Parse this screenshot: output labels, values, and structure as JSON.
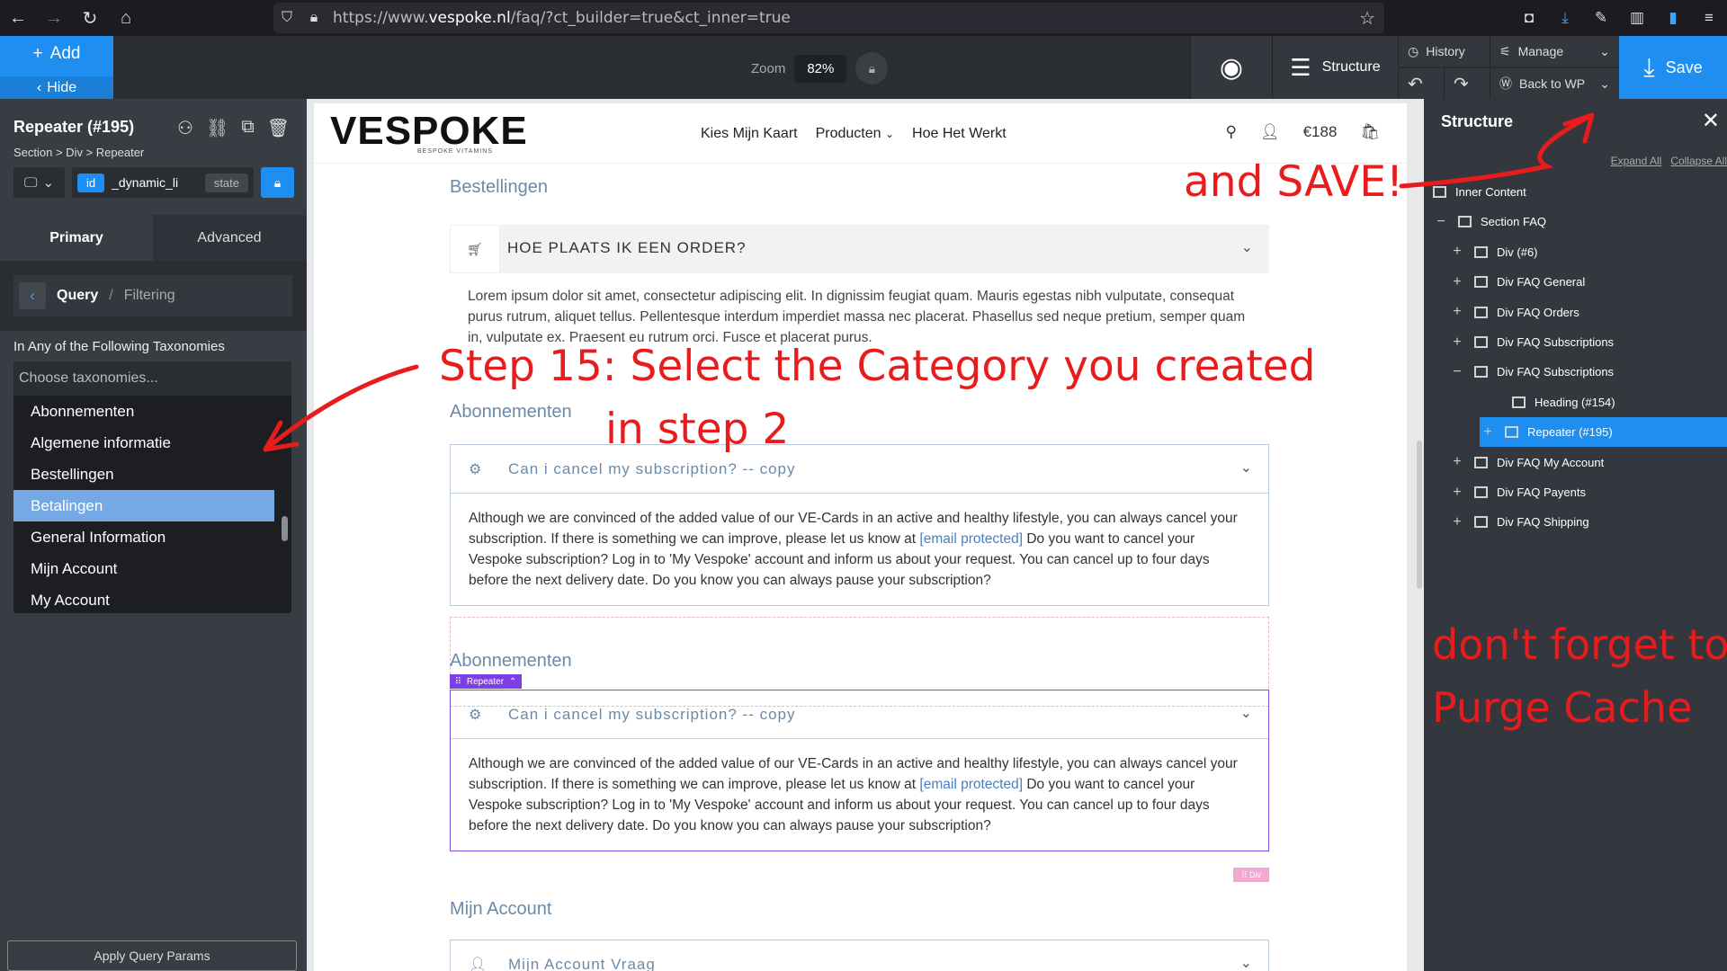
{
  "browser": {
    "url_prefix": "https://www.",
    "url_domain": "vespoke.nl",
    "url_rest": "/faq/?ct_builder=true&ct_inner=true"
  },
  "toolbar": {
    "add_label": "Add",
    "hide_label": "Hide",
    "zoom_label": "Zoom",
    "zoom_value": "82%",
    "structure_label": "Structure",
    "history_label": "History",
    "manage_label": "Manage",
    "back_label": "Back to WP",
    "save_label": "Save"
  },
  "left_panel": {
    "title": "Repeater (#195)",
    "breadcrumb": "Section > Div > Repeater",
    "selector_id": "id",
    "selector_name": "_dynamic_li",
    "selector_state": "state",
    "tabs": [
      "Primary",
      "Advanced"
    ],
    "sub_query": "Query",
    "sub_sep": "/",
    "sub_filter": "Filtering",
    "taxonomy_label": "In Any of the Following Taxonomies",
    "taxonomy_placeholder": "Choose taxonomies...",
    "taxonomy_options": [
      "Abonnementen",
      "Algemene informatie",
      "Bestellingen",
      "Betalingen",
      "General Information",
      "Mijn Account",
      "My Account"
    ],
    "selected_index": 3,
    "apply_label": "Apply Query Params"
  },
  "site": {
    "logo": "VESPOKE",
    "logo_sub": "BESPOKE VITAMINS",
    "menu": [
      "Kies Mijn Kaart",
      "Producten",
      "Hoe Het Werkt"
    ],
    "cart_amount": "€188",
    "section1": "Bestellingen",
    "q1": "HOE PLAATS IK EEN ORDER?",
    "lorem": "Lorem ipsum dolor sit amet, consectetur adipiscing elit. In dignissim feugiat quam. Mauris egestas nibh vulputate, consequat purus rutrum, aliquet tellus. Pellentesque interdum imperdiet massa nec placerat. Phasellus sed neque pretium, semper quam in, vulputate ex. Praesent eu rutrum orci. Fusce et placerat purus.",
    "section2": "Abonnementen",
    "q2": "Can i cancel my subscription? -- copy",
    "a2_part1": "Although we are convinced of the added value of our VE-Cards in an active and healthy lifestyle, you can always cancel your subscription. If there is something we can improve, please let us know at ",
    "a2_email": "[email protected]",
    "a2_part2": " Do you want to cancel your Vespoke subscription? Log in to 'My Vespoke' account and inform us about your request. You can cancel up to four days before the next delivery date. Do you know you can always pause your subscription?",
    "repeater_tag": "Repeater",
    "div_tag": "Div",
    "section3": "Mijn Account",
    "q3": "Mijn Account Vraag"
  },
  "structure": {
    "title": "Structure",
    "expand_all": "Expand All",
    "collapse_all": "Collapse All",
    "items": [
      {
        "label": "Inner Content",
        "level": 0,
        "toggle": ""
      },
      {
        "label": "Section FAQ",
        "level": 0,
        "toggle": "−"
      },
      {
        "label": "Div (#6)",
        "level": 1,
        "toggle": "+"
      },
      {
        "label": "Div FAQ General",
        "level": 1,
        "toggle": "+"
      },
      {
        "label": "Div FAQ Orders",
        "level": 1,
        "toggle": "+"
      },
      {
        "label": "Div FAQ Subscriptions",
        "level": 1,
        "toggle": "+"
      },
      {
        "label": "Div FAQ Subscriptions",
        "level": 1,
        "toggle": "−"
      },
      {
        "label": "Heading (#154)",
        "level": 2,
        "toggle": ""
      },
      {
        "label": "Repeater (#195)",
        "level": 2,
        "toggle": "+"
      },
      {
        "label": "Div FAQ My Account",
        "level": 1,
        "toggle": "+"
      },
      {
        "label": "Div FAQ Payents",
        "level": 1,
        "toggle": "+"
      },
      {
        "label": "Div FAQ Shipping",
        "level": 1,
        "toggle": "+"
      }
    ],
    "selected_index": 8
  },
  "annotations": {
    "step_line1": "Step 15: Select the Category you created",
    "step_line2": "in step 2",
    "save": "and SAVE!",
    "purge1": "don't forget to",
    "purge2": "Purge Cache",
    "color": "#e81c1c"
  }
}
